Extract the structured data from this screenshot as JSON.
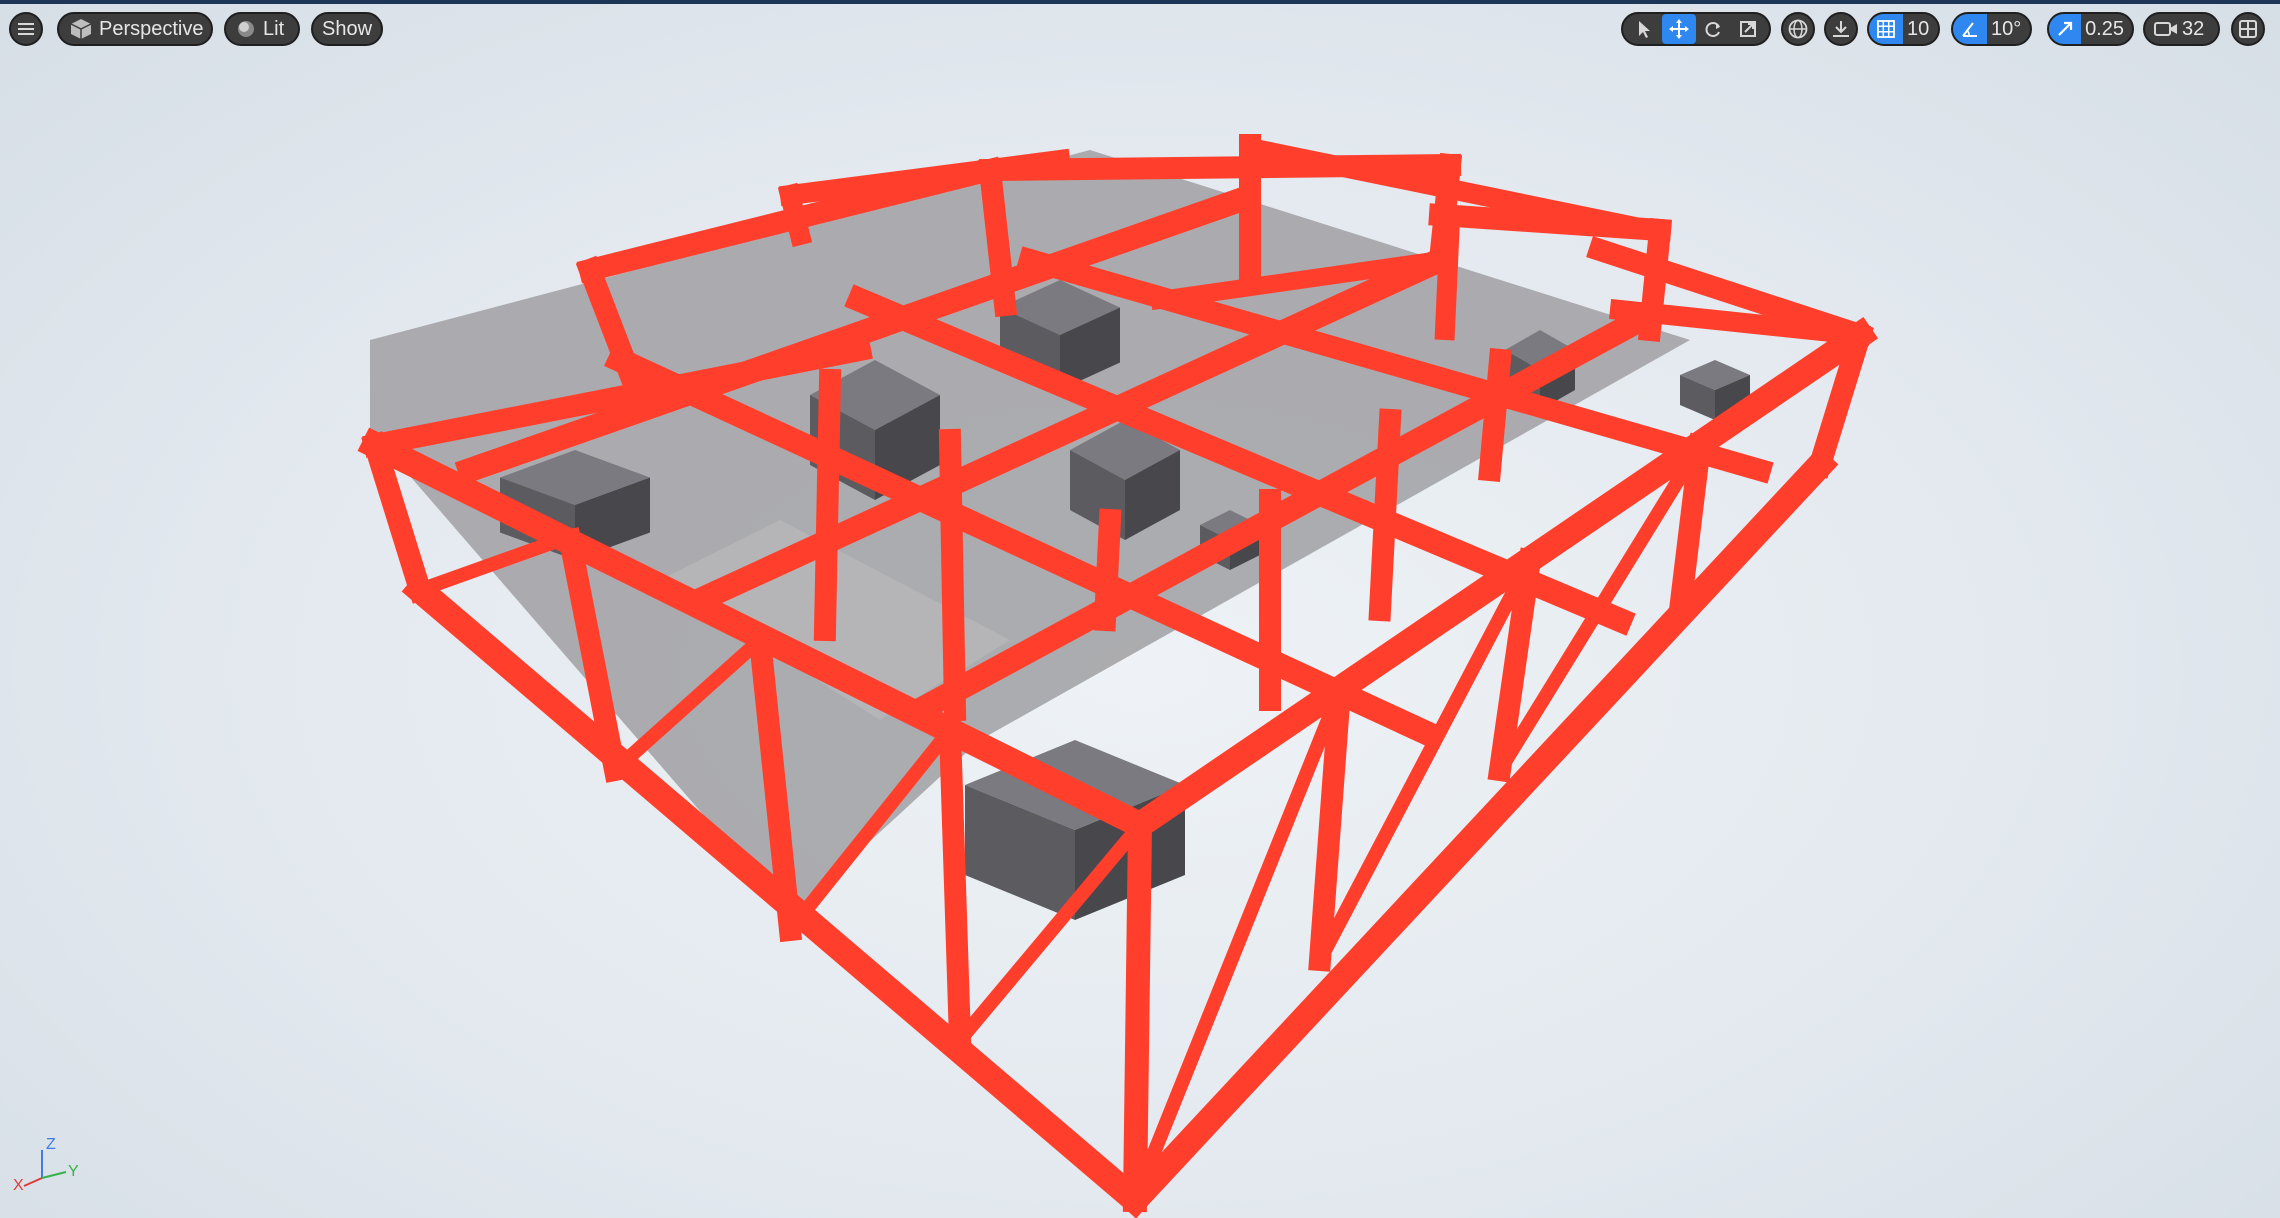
{
  "toolbar_left": {
    "menu_icon": "hamburger-menu-icon",
    "view_mode_label": "Perspective",
    "lighting_label": "Lit",
    "show_label": "Show"
  },
  "toolbar_right": {
    "tools": [
      "select-tool-icon",
      "translate-tool-icon",
      "rotate-tool-icon",
      "scale-tool-icon"
    ],
    "active_tool": "translate-tool-icon",
    "coordinate_space_icon": "world-space-globe-icon",
    "surface_snap_icon": "surface-snapping-icon",
    "grid_snap_value": "10",
    "rotation_snap_value": "10°",
    "scale_snap_value": "0.25",
    "camera_speed_value": "32",
    "layout_icon": "viewport-layout-icon"
  },
  "axis_gizmo": {
    "x": "X",
    "y": "Y",
    "z": "Z"
  },
  "colors": {
    "frame": "#ff3f2c",
    "floor": "#a8a8ab",
    "crate": "#5b5b60",
    "accent": "#2f87f0",
    "toolbar_bg": "#3d3d3d"
  }
}
